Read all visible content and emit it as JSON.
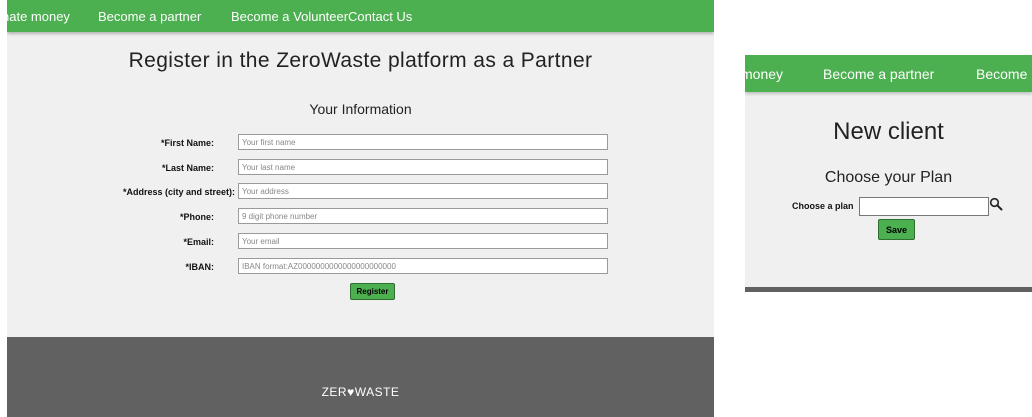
{
  "left": {
    "nav": {
      "items": [
        "nate money",
        "Become a partner",
        "Become a Volunteer",
        "Contact Us"
      ]
    },
    "title": "Register in the ZeroWaste platform as a Partner",
    "section_title": "Your Information",
    "form": {
      "fields": [
        {
          "label": "*First Name:",
          "placeholder": "Your first name"
        },
        {
          "label": "*Last Name:",
          "placeholder": "Your last name"
        },
        {
          "label": "*Address (city and street):",
          "placeholder": "Your address"
        },
        {
          "label": "*Phone:",
          "placeholder": "9 digit phone number"
        },
        {
          "label": "*Email:",
          "placeholder": "Your email"
        },
        {
          "label": "*IBAN:",
          "placeholder": "IBAN format:AZ0000000000000000000000"
        }
      ],
      "register_label": "Register"
    },
    "footer": {
      "logo_pre": "ZER",
      "logo_heart": "♥",
      "logo_post": "WASTE"
    }
  },
  "right": {
    "nav": {
      "items": [
        "money",
        "Become a partner",
        "Become"
      ]
    },
    "title": "New client",
    "section_title": "Choose your Plan",
    "plan_label": "Choose a plan",
    "plan_value": "",
    "save_label": "Save"
  },
  "colors": {
    "nav_green": "#4caf50",
    "footer_gray": "#616161",
    "page_bg": "#f0f0f0"
  }
}
